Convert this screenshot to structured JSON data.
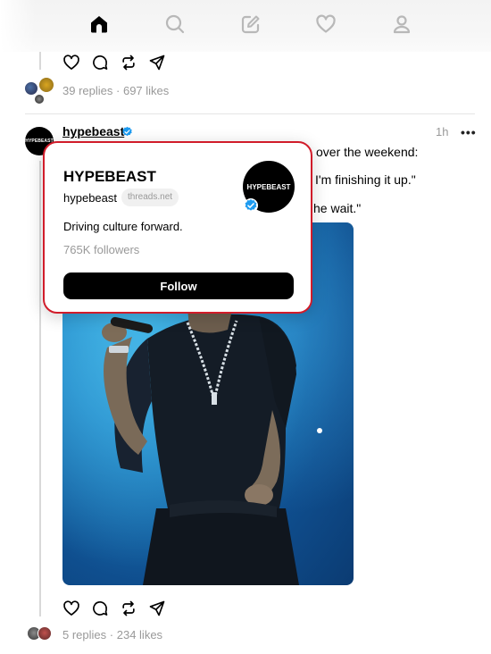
{
  "nav": {
    "items": [
      {
        "icon": "home-icon",
        "active": true
      },
      {
        "icon": "search-icon",
        "active": false
      },
      {
        "icon": "compose-icon",
        "active": false
      },
      {
        "icon": "heart-icon",
        "active": false
      },
      {
        "icon": "profile-icon",
        "active": false
      }
    ]
  },
  "prev_post": {
    "replies": "39 replies",
    "separator": "·",
    "likes": "697 likes"
  },
  "post": {
    "username": "hypebeast",
    "avatar_text": "HYPEBEAST",
    "time": "1h",
    "more": "•••",
    "text_line1": "over the weekend:",
    "text_line2": "I'm finishing it up.\"",
    "text_line3": "he wait.\"",
    "replies": "5 replies",
    "separator": "·",
    "likes": "234 likes"
  },
  "popup": {
    "name": "HYPEBEAST",
    "handle": "hypebeast",
    "domain": "threads.net",
    "bio": "Driving culture forward.",
    "followers": "765K followers",
    "follow_label": "Follow",
    "avatar_text": "HYPEBEAST"
  },
  "colors": {
    "verified": "#1d9bf0",
    "highlight_border": "#d11c2a",
    "muted": "#999999"
  }
}
